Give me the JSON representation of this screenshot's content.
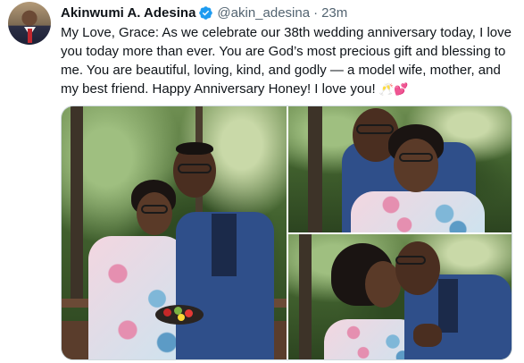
{
  "tweet": {
    "author_name": "Akinwumi A. Adesina",
    "handle": "@akin_adesina",
    "separator": "·",
    "time": "23m",
    "text": "My Love, Grace: As we celebrate our 38th wedding anniversary today, I love you today more than ever. You are God’s most precious gift and blessing to me. You are beautiful, loving, kind, and godly — a model wife, mother, and my best friend. Happy Anniversary Honey! I love you!",
    "emojis": "🥂💕"
  },
  "colors": {
    "verified_badge": "#1d9bf0",
    "secondary_text": "#536471",
    "primary_text": "#0f1419"
  },
  "icons": {
    "verified": "verified-badge-icon"
  }
}
